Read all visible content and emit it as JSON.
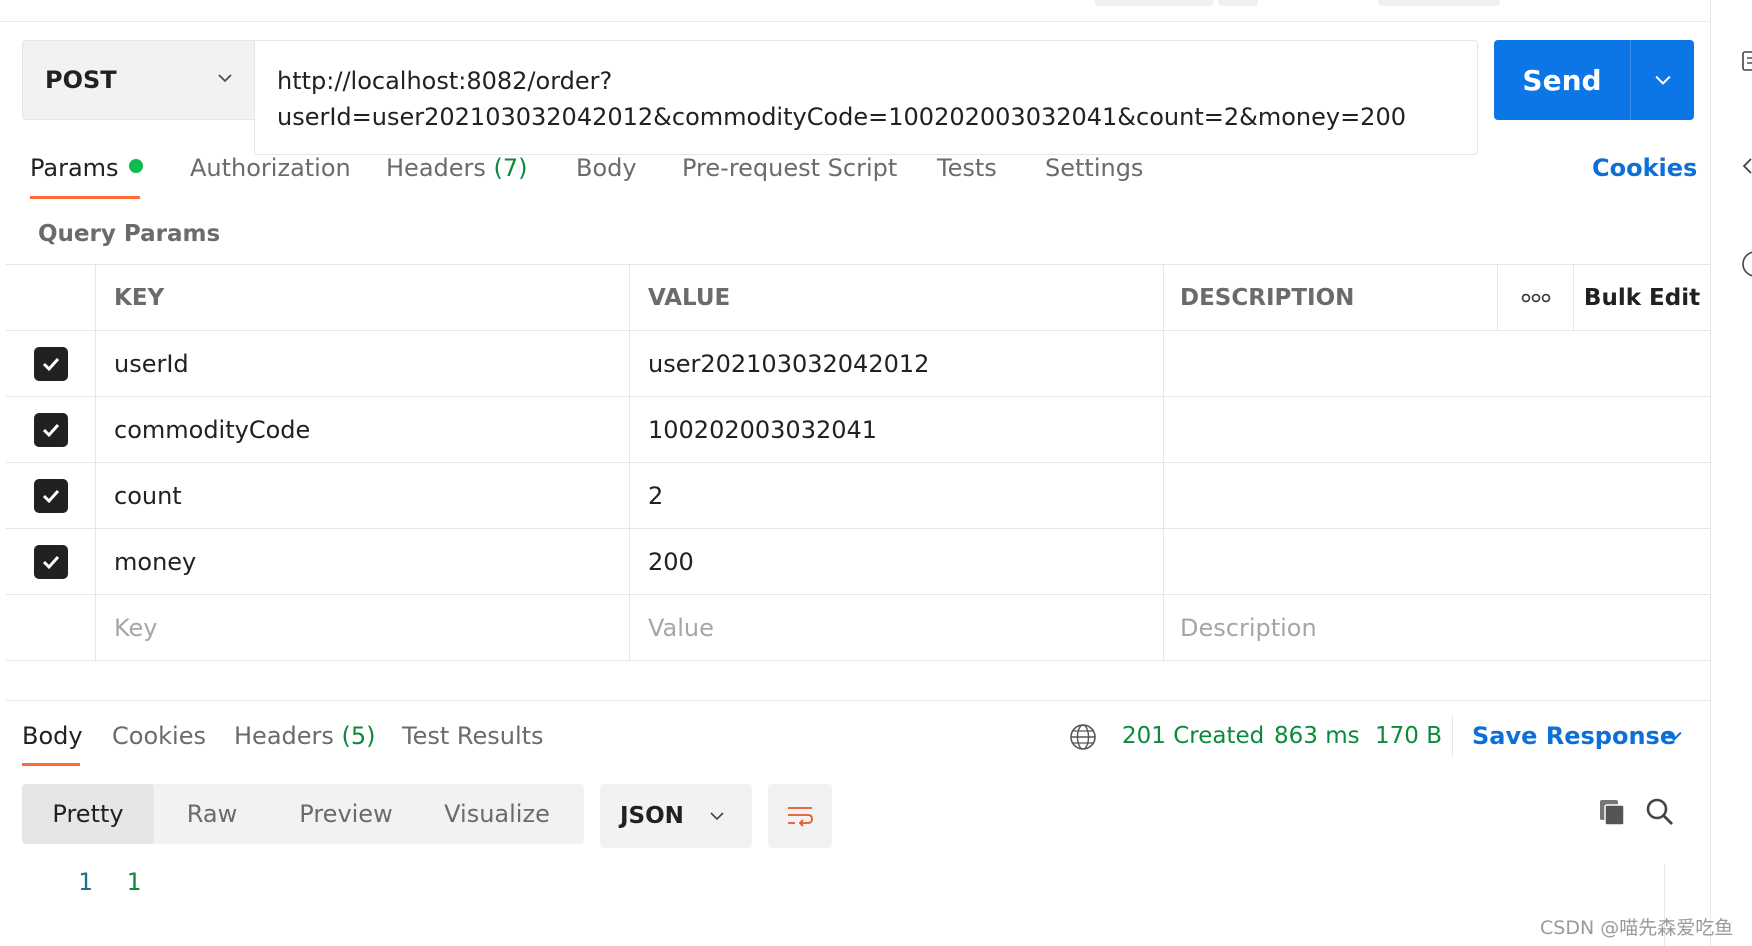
{
  "request": {
    "method": "POST",
    "url_line1": "http://localhost:8082/order?",
    "url_line2": "userId=user202103032042012&commodityCode=100202003032041&count=2&money=200",
    "send_label": "Send"
  },
  "request_tabs": [
    {
      "label": "Params",
      "count": ""
    },
    {
      "label": "Authorization",
      "count": ""
    },
    {
      "label": "Headers",
      "count": "(7)"
    },
    {
      "label": "Body",
      "count": ""
    },
    {
      "label": "Pre-request Script",
      "count": ""
    },
    {
      "label": "Tests",
      "count": ""
    },
    {
      "label": "Settings",
      "count": ""
    }
  ],
  "cookies_link": "Cookies",
  "query_params": {
    "title": "Query Params",
    "columns": {
      "key": "KEY",
      "value": "VALUE",
      "description": "DESCRIPTION",
      "bulk_edit": "Bulk Edit"
    },
    "rows": [
      {
        "key": "userId",
        "value": "user202103032042012",
        "description": "",
        "checked": true
      },
      {
        "key": "commodityCode",
        "value": "100202003032041",
        "description": "",
        "checked": true
      },
      {
        "key": "count",
        "value": "2",
        "description": "",
        "checked": true
      },
      {
        "key": "money",
        "value": "200",
        "description": "",
        "checked": true
      }
    ],
    "placeholders": {
      "key": "Key",
      "value": "Value",
      "description": "Description"
    }
  },
  "response_tabs": [
    {
      "label": "Body",
      "count": ""
    },
    {
      "label": "Cookies",
      "count": ""
    },
    {
      "label": "Headers",
      "count": "(5)"
    },
    {
      "label": "Test Results",
      "count": ""
    }
  ],
  "response_meta": {
    "status": "201 Created",
    "time": "863 ms",
    "size": "170 B",
    "save_label": "Save Response"
  },
  "view_modes": [
    "Pretty",
    "Raw",
    "Preview",
    "Visualize"
  ],
  "format": "JSON",
  "response_body": {
    "line_number": "1",
    "content": "1"
  },
  "watermark": "CSDN @喵先森爱吃鱼",
  "colors": {
    "accent": "#0d76e6",
    "tab_underline": "#ff6c37",
    "status_green": "#0c8a3b",
    "link_blue": "#0d6fd8"
  }
}
